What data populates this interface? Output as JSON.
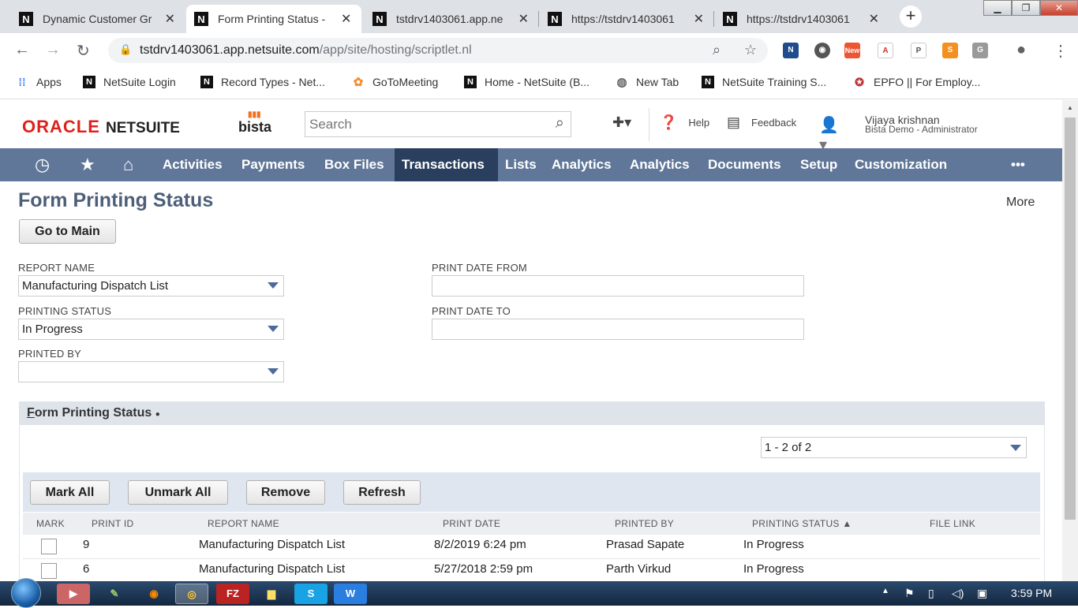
{
  "browser": {
    "tabs": [
      {
        "title": "Dynamic Customer Gr",
        "active": false
      },
      {
        "title": "Form Printing Status -",
        "active": true
      },
      {
        "title": "tstdrv1403061.app.ne",
        "active": false
      },
      {
        "title": "https://tstdrv1403061",
        "active": false
      },
      {
        "title": "https://tstdrv1403061",
        "active": false
      }
    ],
    "url_domain": "tstdrv1403061.app.netsuite.com",
    "url_path": "/app/site/hosting/scriptlet.nl",
    "extension_badge": "New",
    "bookmarks": [
      {
        "label": "Apps",
        "icon": "apps-grid-icon"
      },
      {
        "label": "NetSuite Login",
        "icon": "netsuite-icon"
      },
      {
        "label": "Record Types - Net...",
        "icon": "netsuite-icon"
      },
      {
        "label": "GoToMeeting",
        "icon": "gotomeeting-icon"
      },
      {
        "label": "Home - NetSuite (B...",
        "icon": "netsuite-icon"
      },
      {
        "label": "New Tab",
        "icon": "globe-icon"
      },
      {
        "label": "NetSuite Training S...",
        "icon": "netsuite-icon"
      },
      {
        "label": "EPFO || For Employ...",
        "icon": "epfo-icon"
      }
    ]
  },
  "header": {
    "brand_oracle": "ORACLE",
    "brand_netsuite": "NETSUITE",
    "brand_bista": "bista",
    "search_placeholder": "Search",
    "help": "Help",
    "feedback": "Feedback",
    "user_name": "Vijaya krishnan",
    "user_role": "Bista Demo - Administrator"
  },
  "nav": {
    "items": [
      "Activities",
      "Payments",
      "Box Files",
      "Transactions",
      "Lists",
      "Analytics",
      "Analytics",
      "Documents",
      "Setup",
      "Customization"
    ],
    "active": "Transactions",
    "overflow": "•••"
  },
  "page": {
    "title": "Form Printing Status",
    "more": "More",
    "go_to_main": "Go to Main"
  },
  "filters": {
    "report_name_label": "REPORT NAME",
    "report_name_value": "Manufacturing Dispatch List",
    "printing_status_label": "PRINTING STATUS",
    "printing_status_value": "In Progress",
    "printed_by_label": "PRINTED BY",
    "printed_by_value": "",
    "print_date_from_label": "PRINT DATE FROM",
    "print_date_from_value": "",
    "print_date_to_label": "PRINT DATE TO",
    "print_date_to_value": ""
  },
  "sublist": {
    "tab_label_first": "F",
    "tab_label_rest": "orm Printing Status",
    "tab_dot": "●",
    "pager": "1 - 2 of 2",
    "buttons": {
      "mark_all": "Mark All",
      "unmark_all": "Unmark All",
      "remove": "Remove",
      "refresh": "Refresh"
    },
    "columns": [
      "MARK",
      "PRINT ID",
      "REPORT NAME",
      "PRINT DATE",
      "PRINTED BY",
      "PRINTING STATUS ▲",
      "FILE LINK"
    ],
    "rows": [
      {
        "print_id": "9",
        "report_name": "Manufacturing Dispatch List",
        "print_date": "8/2/2019 6:24 pm",
        "printed_by": "Prasad Sapate",
        "status": "In Progress",
        "file_link": ""
      },
      {
        "print_id": "6",
        "report_name": "Manufacturing Dispatch List",
        "print_date": "5/27/2018 2:59 pm",
        "printed_by": "Parth Virkud",
        "status": "In Progress",
        "file_link": ""
      }
    ]
  },
  "taskbar": {
    "clock": "3:59 PM"
  },
  "colors": {
    "nav_bg": "#607799",
    "nav_active": "#2a3f5e",
    "title": "#4d5f79",
    "oracle_red": "#e0201b"
  }
}
